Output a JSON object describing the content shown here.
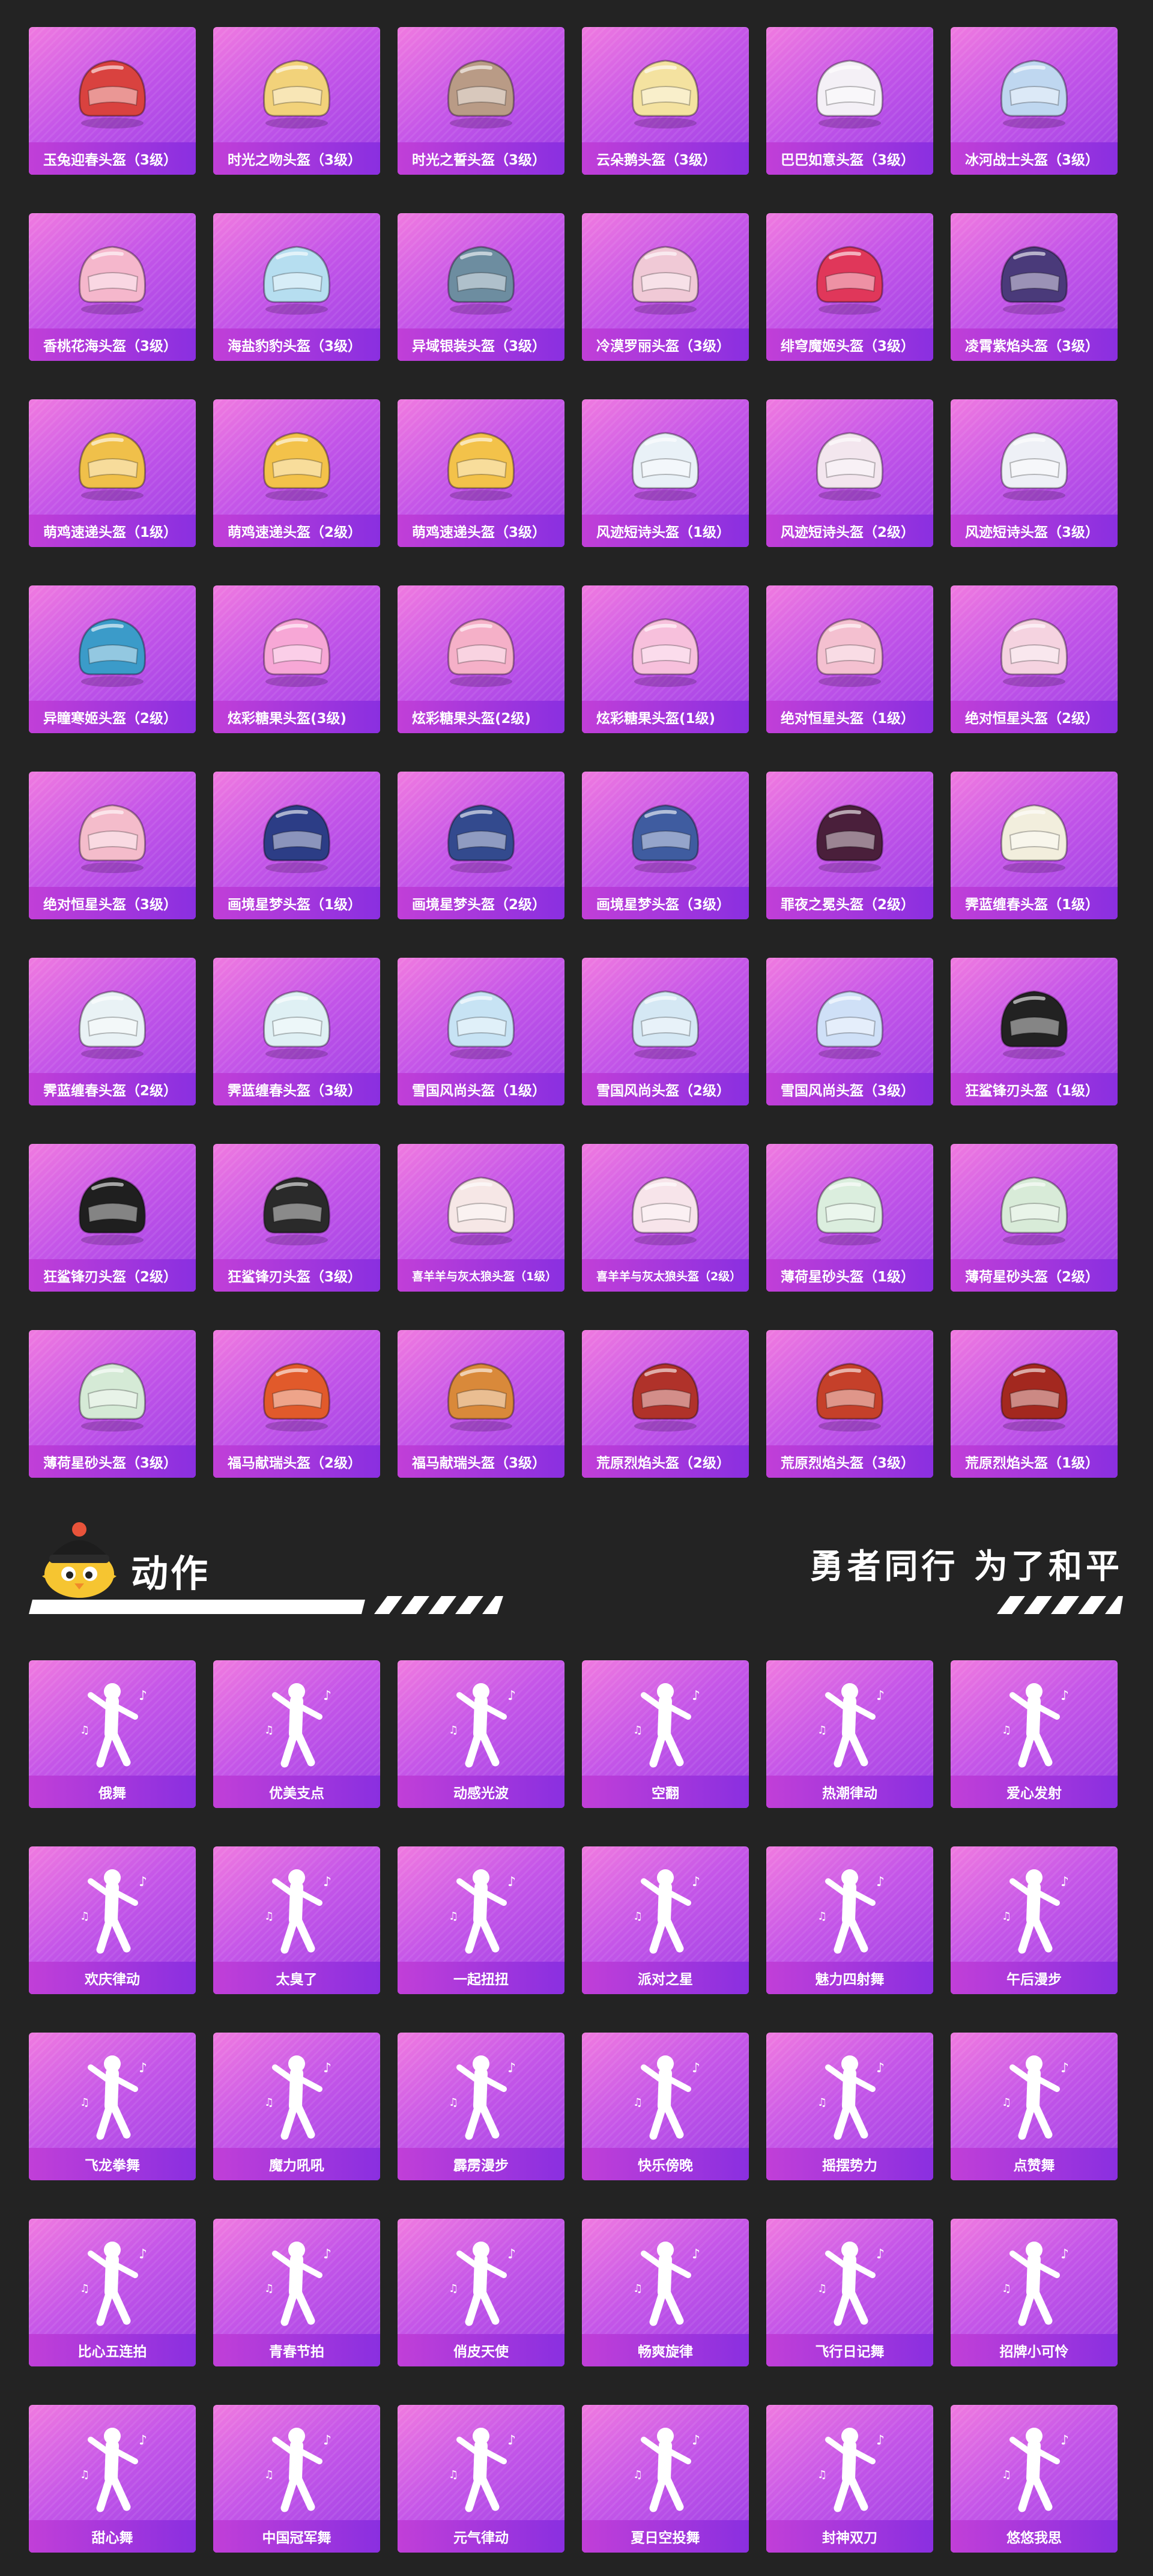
{
  "helmets": [
    "玉兔迎春头盔（3级）",
    "时光之吻头盔（3级）",
    "时光之誓头盔（3级）",
    "云朵鹅头盔（3级）",
    "巴巴如意头盔（3级）",
    "冰河战士头盔（3级）",
    "香桃花海头盔（3级）",
    "海盐豹豹头盔（3级）",
    "异域银装头盔（3级）",
    "冷漠罗丽头盔（3级）",
    "绯穹魔姬头盔（3级）",
    "凌霄紫焰头盔（3级）",
    "萌鸡速递头盔（1级）",
    "萌鸡速递头盔（2级）",
    "萌鸡速递头盔（3级）",
    "风迹短诗头盔（1级）",
    "风迹短诗头盔（2级）",
    "风迹短诗头盔（3级）",
    "异瞳寒姬头盔（2级）",
    "炫彩糖果头盔(3级)",
    "炫彩糖果头盔(2级)",
    "炫彩糖果头盔(1级)",
    "绝对恒星头盔（1级）",
    "绝对恒星头盔（2级）",
    "绝对恒星头盔（3级）",
    "画境星梦头盔（1级）",
    "画境星梦头盔（2级）",
    "画境星梦头盔（3级）",
    "罪夜之冕头盔（2级）",
    "霁蓝缠春头盔（1级）",
    "霁蓝缠春头盔（2级）",
    "霁蓝缠春头盔（3级）",
    "雪国风尚头盔（1级）",
    "雪国风尚头盔（2级）",
    "雪国风尚头盔（3级）",
    "狂鲨锋刃头盔（1级）",
    "狂鲨锋刃头盔（2级）",
    "狂鲨锋刃头盔（3级）",
    "喜羊羊与灰太狼头盔（1级）",
    "喜羊羊与灰太狼头盔（2级）",
    "薄荷星砂头盔（1级）",
    "薄荷星砂头盔（2级）",
    "薄荷星砂头盔（3级）",
    "福马献瑞头盔（2级）",
    "福马献瑞头盔（3级）",
    "荒原烈焰头盔（2级）",
    "荒原烈焰头盔（3级）",
    "荒原烈焰头盔（1级）"
  ],
  "helmet_colors": [
    "#d9423f",
    "#f2d27a",
    "#b99b86",
    "#f4e2a0",
    "#f4f0f6",
    "#bfd7f0",
    "#f5b7cc",
    "#b6def0",
    "#6d8da0",
    "#f0c9d6",
    "#e0375a",
    "#4a3a7a",
    "#f0c04a",
    "#f3c24a",
    "#f3c24a",
    "#e9f1f7",
    "#f3e6ee",
    "#eef0f6",
    "#3b9bc9",
    "#f7a7d6",
    "#f5b0c8",
    "#f7c0dc",
    "#f4c0d0",
    "#f5d3e0",
    "#f4bccb",
    "#2c3d86",
    "#334a8e",
    "#3f5ca0",
    "#4a1f3b",
    "#f2eedd",
    "#e9f2f5",
    "#dff0f4",
    "#c7e3f4",
    "#d5e8f4",
    "#cfe0f7",
    "#222222",
    "#1f1f1f",
    "#2a2a2a",
    "#f6e7e6",
    "#f7e4ea",
    "#dbeede",
    "#d8ebd8",
    "#d5ead6",
    "#e15a2b",
    "#d9893a",
    "#b0322a",
    "#c5402a",
    "#a3281f"
  ],
  "section": {
    "title": "动作",
    "slogan": "勇者同行 为了和平"
  },
  "emotes": [
    "俄舞",
    "优美支点",
    "动感光波",
    "空翻",
    "热潮律动",
    "爱心发射",
    "欢庆律动",
    "太臭了",
    "一起扭扭",
    "派对之星",
    "魅力四射舞",
    "午后漫步",
    "飞龙拳舞",
    "魔力吼吼",
    "霹雳漫步",
    "快乐傍晚",
    "摇摆势力",
    "点赞舞",
    "比心五连拍",
    "青春节拍",
    "俏皮天使",
    "畅爽旋律",
    "飞行日记舞",
    "招牌小可怜",
    "甜心舞",
    "中国冠军舞",
    "元气律动",
    "夏日空投舞",
    "封神双刀",
    "悠悠我思"
  ]
}
